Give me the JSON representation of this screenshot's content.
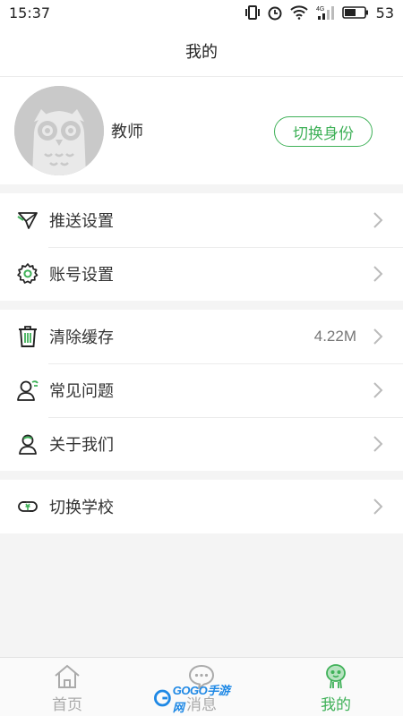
{
  "status_bar": {
    "time": "15:37",
    "battery": "53"
  },
  "header": {
    "title": "我的"
  },
  "profile": {
    "name": "教师",
    "switch_button": "切换身份"
  },
  "menu": {
    "push_settings": "推送设置",
    "account_settings": "账号设置",
    "clear_cache": "清除缓存",
    "cache_size": "4.22M",
    "faq": "常见问题",
    "about_us": "关于我们",
    "switch_school": "切换学校"
  },
  "tabs": {
    "home": "首页",
    "messages": "消息",
    "mine": "我的"
  },
  "colors": {
    "accent": "#3fb158",
    "inactive": "#aaaaaa"
  }
}
